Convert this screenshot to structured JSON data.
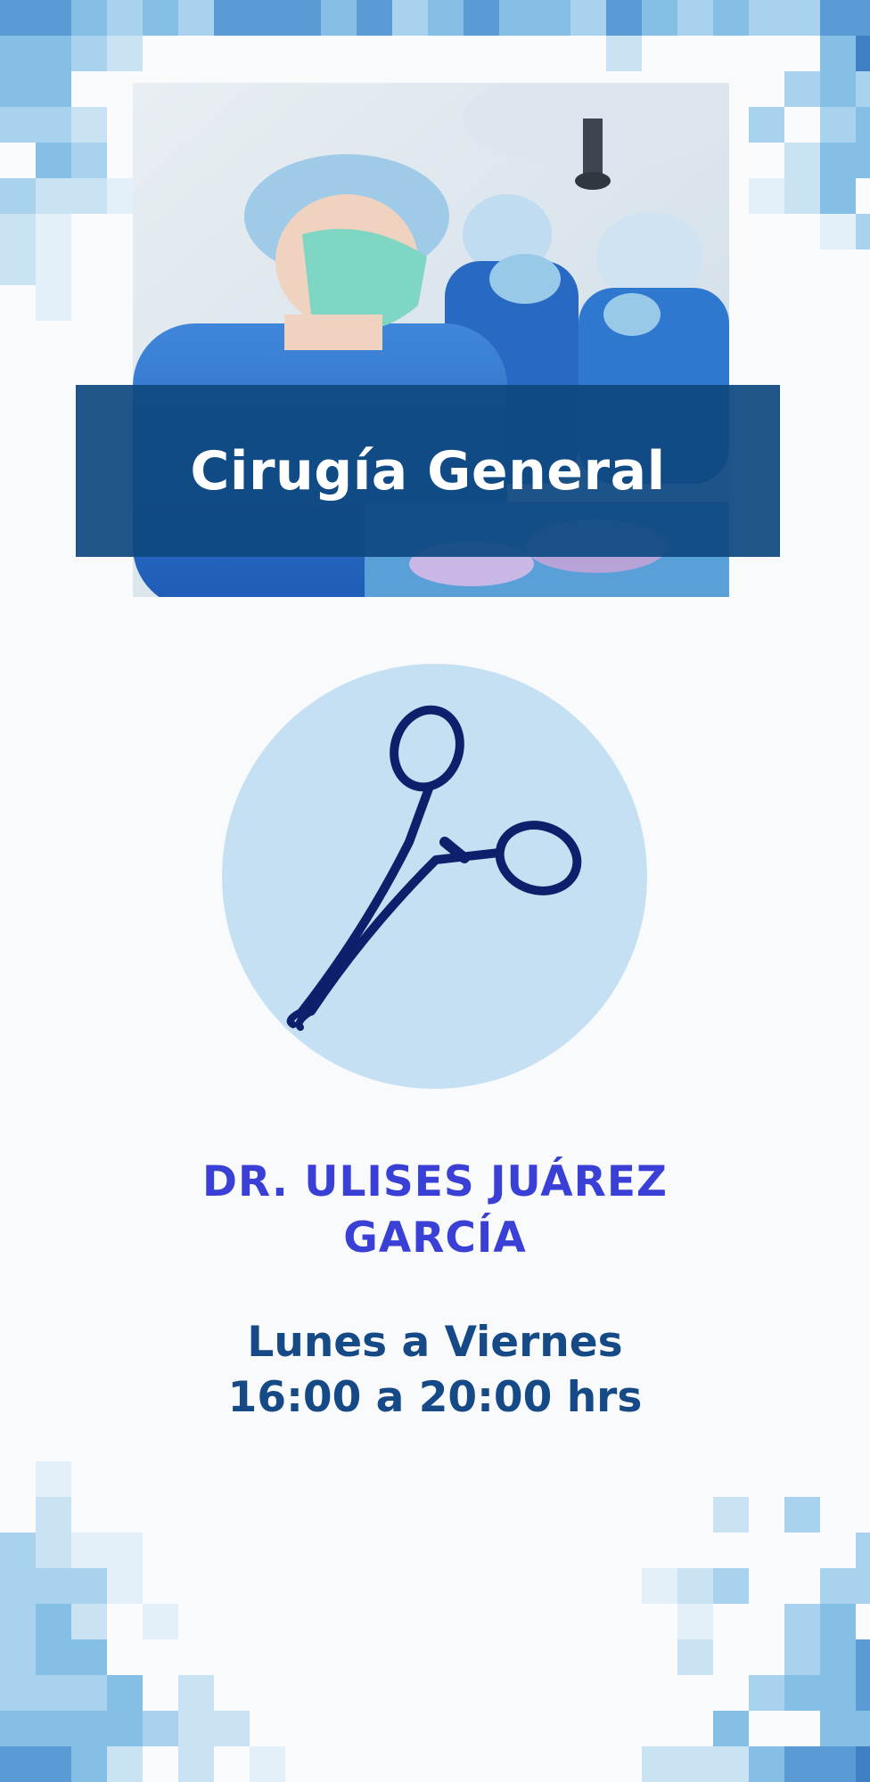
{
  "title": "Cirugía General",
  "doctor": {
    "name_line1": "DR. ULISES JUÁREZ",
    "name_line2": "GARCÍA"
  },
  "schedule": {
    "days": "Lunes a Viernes",
    "hours": "16:00 a 20:00 hrs"
  },
  "icons": {
    "specialty": "surgical-forceps-icon"
  },
  "colors": {
    "background": "#f8fafb",
    "banner": "#0f4880",
    "title_text": "#ffffff",
    "circle": "#c5e0f2",
    "forceps": "#0e1f6b",
    "doctor_text": "#3a3fd6",
    "schedule_text": "#164a86",
    "pixel_palette": [
      "#3f7fc3",
      "#5b9bd5",
      "#86bfe6",
      "#a9d2ee",
      "#c9e3f4",
      "#e4f0f9"
    ]
  }
}
